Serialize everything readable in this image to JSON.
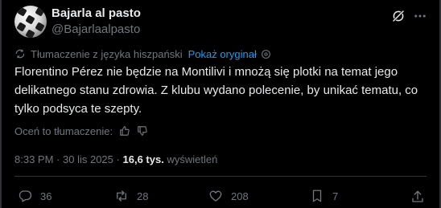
{
  "author": {
    "name": "Bajarla al pasto",
    "handle": "@Bajarlaalpasto"
  },
  "translation": {
    "notice": "Tłumaczenie z języka hiszpański",
    "show_original": "Pokaż oryginał"
  },
  "tweet": {
    "text": "Florentino Pérez nie będzie na Montilivi i mnożą się plotki na temat jego delikatnego stanu zdrowia. Z klubu wydano polecenie, by unikać tematu, co tylko podsyca te szepty."
  },
  "rate": {
    "label": "Oceń to tłumaczenie:"
  },
  "meta": {
    "time": "8:33 PM",
    "separator": "·",
    "date": "30 lis 2025",
    "views_count": "16,6 tys.",
    "views_label": "wyświetleń"
  },
  "actions": {
    "replies": "36",
    "reposts": "28",
    "likes": "208",
    "bookmarks": "7"
  },
  "icons": {
    "translate": "translate-icon",
    "info": "info-icon",
    "thumbs_up": "thumbs-up-icon",
    "thumbs_down": "thumbs-down-icon",
    "grok": "grok-icon",
    "more": "more-icon",
    "reply": "reply-icon",
    "repost": "repost-icon",
    "like": "heart-icon",
    "bookmark": "bookmark-icon",
    "share": "share-icon"
  },
  "colors": {
    "background": "#000000",
    "text_primary": "#e7e9ea",
    "text_secondary": "#71767b",
    "link": "#1d9bf0",
    "divider": "#2f3336"
  }
}
